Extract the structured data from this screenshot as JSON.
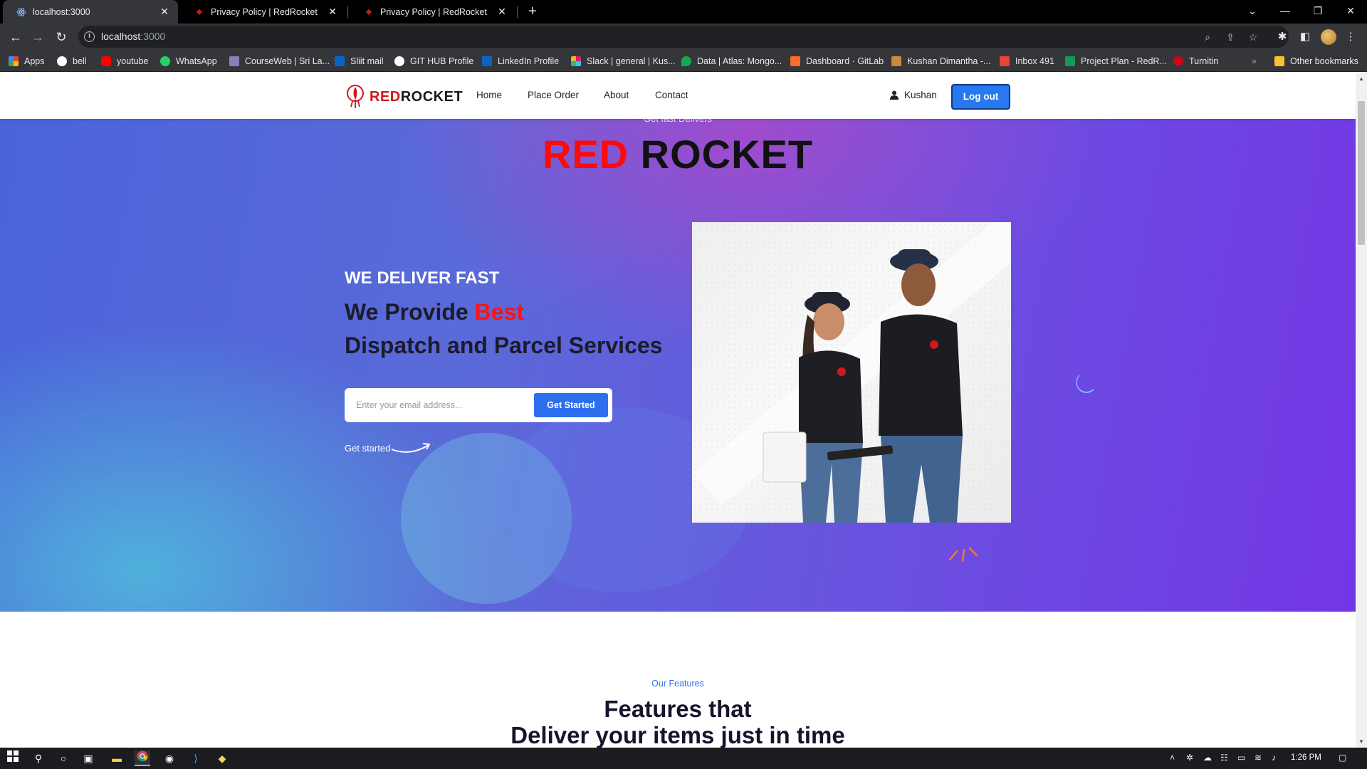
{
  "browser": {
    "tabs": [
      {
        "title": "localhost:3000",
        "icon": "react-icon",
        "active": true
      },
      {
        "title": "Privacy Policy | RedRocket",
        "icon": "rocket-pin-icon",
        "active": false
      },
      {
        "title": "Privacy Policy | RedRocket",
        "icon": "rocket-pin-icon",
        "active": false
      }
    ],
    "address": {
      "host": "localhost",
      "port": ":3000"
    },
    "bookmarks": [
      {
        "label": "Apps",
        "color": "#e94235"
      },
      {
        "label": "bell",
        "color": "#ffffff"
      },
      {
        "label": "youtube",
        "color": "#ff0000"
      },
      {
        "label": "WhatsApp",
        "color": "#25d366"
      },
      {
        "label": "CourseWeb | Sri La...",
        "color": "#8b7fb8"
      },
      {
        "label": "Sliit mail",
        "color": "#0a64c8"
      },
      {
        "label": "GIT HUB Profile",
        "color": "#ffffff"
      },
      {
        "label": "LinkedIn Profile",
        "color": "#0a66c2"
      },
      {
        "label": "Slack | general | Kus...",
        "color": "#e01e5a"
      },
      {
        "label": "Data | Atlas: Mongo...",
        "color": "#13aa52"
      },
      {
        "label": "Dashboard · GitLab",
        "color": "#fc6d26"
      },
      {
        "label": "Kushan Dimantha -...",
        "color": "#c98b3c"
      },
      {
        "label": "Inbox 491",
        "color": "#ea4335"
      },
      {
        "label": "Project Plan - RedR...",
        "color": "#0f9d58"
      },
      {
        "label": "Turnitin",
        "color": "#d0021b"
      }
    ],
    "overflow": "»",
    "other_bookmarks": "Other bookmarks"
  },
  "navbar": {
    "logo": {
      "part1": "RED",
      "part2": "ROCKET"
    },
    "links": [
      "Home",
      "Place Order",
      "About",
      "Contact"
    ],
    "user": "Kushan",
    "logout": "Log out"
  },
  "hero": {
    "eyebrow": "Get fast Delivers",
    "title_red": "RED",
    "title_dark": "ROCKET",
    "kicker": "WE DELIVER FAST",
    "headline_line1": "We Provide ",
    "headline_accent": "Best",
    "headline_line2": "Dispatch and Parcel Services",
    "email_placeholder": "Enter your email address...",
    "cta": "Get Started",
    "link": "Get started"
  },
  "features": {
    "eyebrow": "Our Features",
    "title_line1": "Features that",
    "title_line2": "Deliver your items just in time"
  },
  "taskbar": {
    "clock": "1:26 PM"
  },
  "colors": {
    "brand_red": "#d3171e",
    "accent_blue": "#2b6ff0"
  }
}
